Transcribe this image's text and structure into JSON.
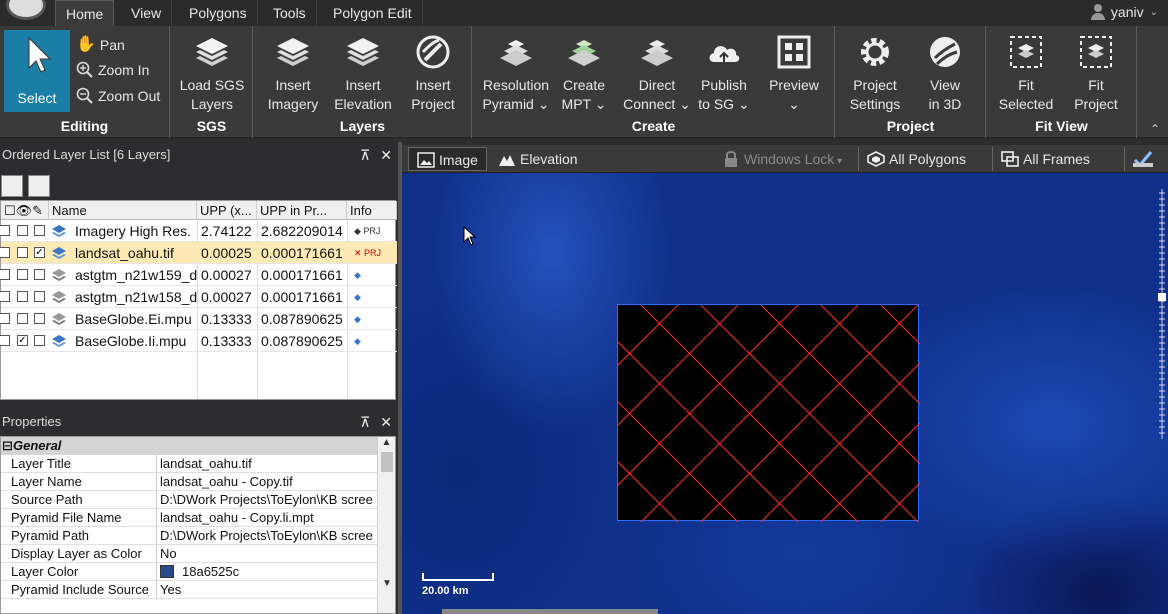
{
  "tabs": [
    "Home",
    "View",
    "Polygons",
    "Tools",
    "Polygon Edit"
  ],
  "user": "yaniv",
  "ribbon": {
    "editing": {
      "label": "Editing",
      "select": "Select",
      "pan": "Pan",
      "zoom_in": "Zoom In",
      "zoom_out": "Zoom Out"
    },
    "sgs": {
      "label": "SGS",
      "load": [
        "Load SGS",
        "Layers"
      ]
    },
    "layers": {
      "label": "Layers",
      "insert_imagery": [
        "Insert",
        "Imagery"
      ],
      "insert_elevation": [
        "Insert",
        "Elevation"
      ],
      "insert_project": [
        "Insert",
        "Project"
      ]
    },
    "create": {
      "label": "Create",
      "resolution_pyramid": [
        "Resolution",
        "Pyramid"
      ],
      "create_mpt": [
        "Create",
        "MPT"
      ],
      "direct_connect": [
        "Direct",
        "Connect"
      ],
      "publish": [
        "Publish",
        "to SG"
      ],
      "preview": [
        "Preview",
        ""
      ]
    },
    "project": {
      "label": "Project",
      "settings": [
        "Project",
        "Settings"
      ],
      "view3d": [
        "View",
        "in 3D"
      ]
    },
    "fitview": {
      "label": "Fit View",
      "fit_selected": [
        "Fit",
        "Selected"
      ],
      "fit_project": [
        "Fit",
        "Project"
      ]
    }
  },
  "layer_panel": {
    "title": "Ordered Layer List [6 Layers]",
    "columns": [
      "Name",
      "UPP (x...",
      "UPP in Pr...",
      "Info"
    ],
    "rows": [
      {
        "name": "Imagery High Res.",
        "upp": "2.74122",
        "upp_pr": "2.682209014",
        "selected": false,
        "checked": false
      },
      {
        "name": "landsat_oahu.tif",
        "upp": "0.00025",
        "upp_pr": "0.000171661",
        "selected": true,
        "checked": true
      },
      {
        "name": "astgtm_n21w159_d",
        "upp": "0.00027",
        "upp_pr": "0.000171661",
        "selected": false,
        "checked": false
      },
      {
        "name": "astgtm_n21w158_d",
        "upp": "0.00027",
        "upp_pr": "0.000171661",
        "selected": false,
        "checked": false
      },
      {
        "name": "BaseGlobe.Ei.mpu",
        "upp": "0.13333",
        "upp_pr": "0.087890625",
        "selected": false,
        "checked": false
      },
      {
        "name": "BaseGlobe.Ii.mpu",
        "upp": "0.13333",
        "upp_pr": "0.087890625",
        "selected": false,
        "checked": true
      }
    ]
  },
  "properties": {
    "title": "Properties",
    "group": "General",
    "rows": [
      {
        "k": "Layer Title",
        "v": "landsat_oahu.tif"
      },
      {
        "k": "Layer Name",
        "v": "landsat_oahu - Copy.tif"
      },
      {
        "k": "Source Path",
        "v": "D:\\DWork Projects\\ToEylon\\KB scree"
      },
      {
        "k": "Pyramid File Name",
        "v": "landsat_oahu - Copy.li.mpt"
      },
      {
        "k": "Pyramid Path",
        "v": "D:\\DWork Projects\\ToEylon\\KB scree"
      },
      {
        "k": "Display Layer as Color",
        "v": "No"
      },
      {
        "k": "Layer Color",
        "v": "18a6525c"
      },
      {
        "k": "Pyramid Include Source",
        "v": "Yes"
      }
    ],
    "layer_color_swatch": "#2b4a8c"
  },
  "map_toolbar": {
    "image": "Image",
    "elevation": "Elevation",
    "windows_lock": "Windows Lock",
    "all_polygons": "All Polygons",
    "all_frames": "All Frames"
  },
  "map": {
    "scale_label": "20.00  km"
  },
  "colors": {
    "accent": "#1b7ea6",
    "selection": "#fde9b3",
    "grid": "#ff2a2a",
    "footprint_border": "#2d6cff"
  }
}
